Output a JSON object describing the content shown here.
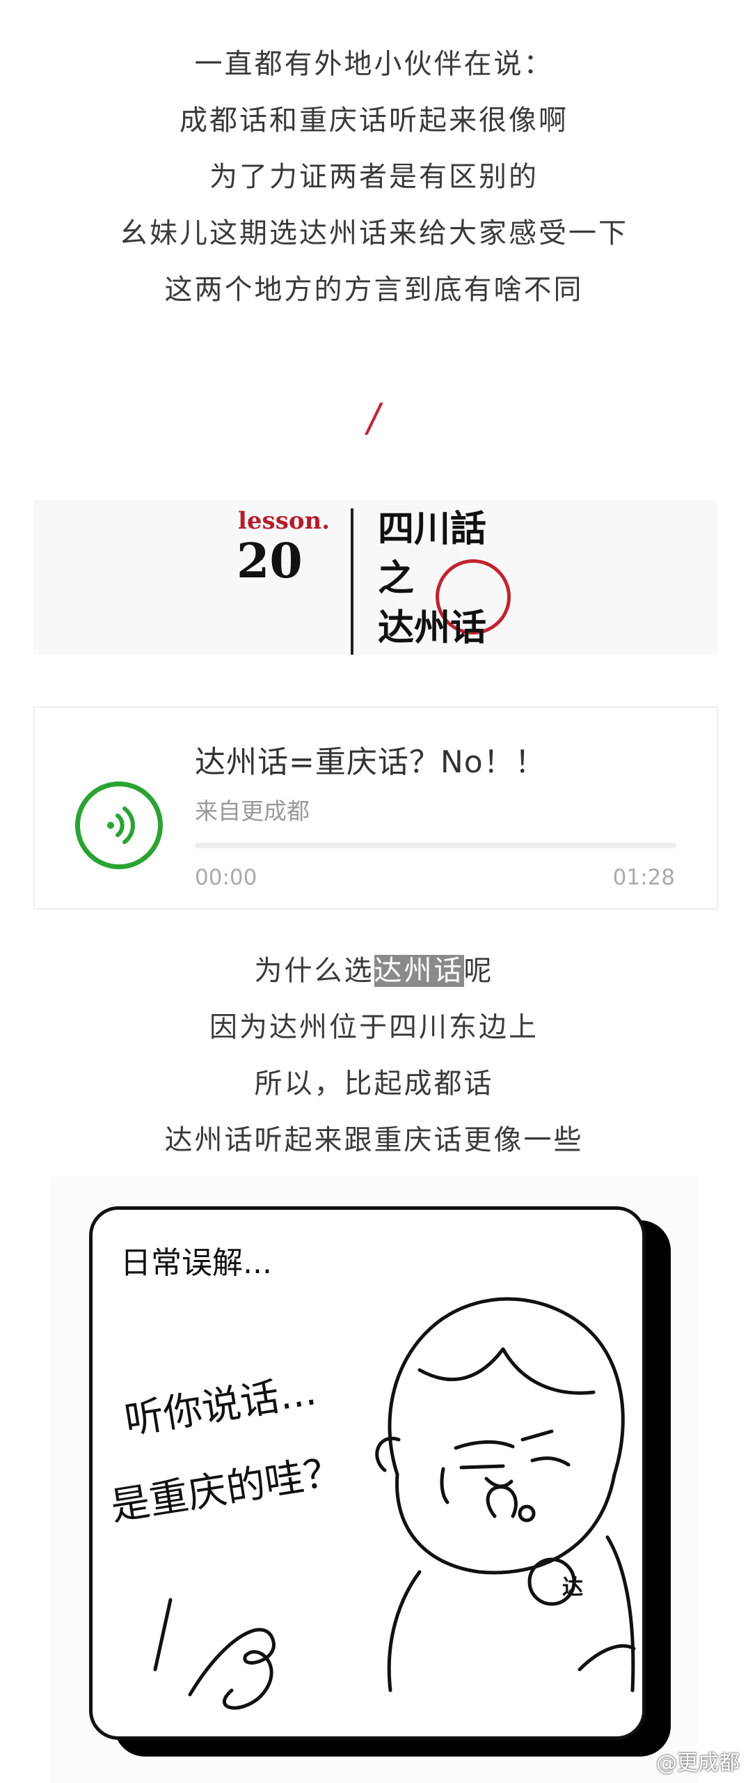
{
  "intro": {
    "lines": [
      "一直都有外地小伙伴在说：",
      "成都话和重庆话听起来很像啊",
      "为了力证两者是有区别的",
      "幺妹儿这期选达州话来给大家感受一下",
      "这两个地方的方言到底有啥不同"
    ]
  },
  "divider": {
    "glyph": "/",
    "color": "#c1273a"
  },
  "banner": {
    "lesson_word": "lesson.",
    "lesson_number": "20",
    "title_lines": [
      "四川話",
      "之",
      "达州话"
    ]
  },
  "audio": {
    "title": "达州话=重庆话？No！！",
    "source": "来自更成都",
    "current_time": "00:00",
    "duration": "01:28",
    "progress": 0,
    "accent_color": "#2aa332",
    "icon": "sound-wave-icon"
  },
  "middle": {
    "line1_pre": "为什么选",
    "line1_highlight": "达州话",
    "line1_post": "呢",
    "line2": "因为达州位于四川东边上",
    "line3": "所以，比起成都话",
    "line4": "达州话听起来跟重庆话更像一些"
  },
  "comic": {
    "header": "日常误解...",
    "speech_line1": "听你说话...",
    "speech_line2": "是重庆的哇？",
    "badge": "达"
  },
  "watermark": {
    "text": "@更成都"
  }
}
